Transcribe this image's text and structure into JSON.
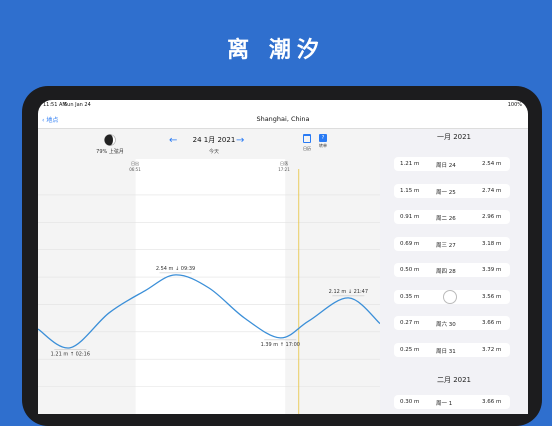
{
  "headline": "离 潮汐",
  "status_bar": {
    "time": "11:51 AM",
    "date": "Sun Jan 24",
    "right": "100%"
  },
  "nav": {
    "back_label": "地点",
    "title": "Shanghai, China"
  },
  "moon": {
    "percent_label": "79% 上弦月"
  },
  "date_nav": {
    "date": "24 1月 2021",
    "sub": "今天",
    "prev_icon": "arrow-left-icon",
    "next_icon": "arrow-right-icon"
  },
  "toolbar": {
    "calendar_label": "日历",
    "calendar_icon": "calendar-icon",
    "today_label": "转单",
    "today_icon": "question-icon"
  },
  "sun": {
    "sunrise_label": "日出",
    "sunrise_time": "06:51",
    "sunset_label": "日落",
    "sunset_time": "17:21"
  },
  "chart_data": {
    "type": "line",
    "x_range_hours": [
      0,
      24
    ],
    "y_range_m": [
      0,
      4.4
    ],
    "daylight_hours": [
      6.85,
      17.35
    ],
    "current_hour": 18.3,
    "series": [
      {
        "values": [
          [
            0,
            1.55
          ],
          [
            2.27,
            1.21
          ],
          [
            5,
            1.85
          ],
          [
            7.5,
            2.25
          ],
          [
            9.65,
            2.54
          ],
          [
            12,
            2.3
          ],
          [
            14.5,
            1.75
          ],
          [
            17,
            1.39
          ],
          [
            19,
            1.7
          ],
          [
            21.78,
            2.12
          ],
          [
            24,
            1.65
          ]
        ]
      }
    ],
    "annotations": [
      {
        "label": "2.54 m ↓ 09:39",
        "hour": 9.65,
        "value": 2.54
      },
      {
        "label": "1.21 m ↑ 02:16",
        "hour": 2.27,
        "value": 1.21
      },
      {
        "label": "1.39 m ↑ 17:00",
        "hour": 17.0,
        "value": 1.39
      },
      {
        "label": "2.12 m ↓ 21:47",
        "hour": 21.78,
        "value": 2.12
      }
    ]
  },
  "sidebar": {
    "month1": "一月 2021",
    "rows": [
      {
        "low": "1.21 m",
        "day": "周日 24",
        "high": "2.54 m"
      },
      {
        "low": "1.15 m",
        "day": "周一 25",
        "high": "2.74 m"
      },
      {
        "low": "0.91 m",
        "day": "周二 26",
        "high": "2.96 m"
      },
      {
        "low": "0.69 m",
        "day": "周三 27",
        "high": "3.18 m"
      },
      {
        "low": "0.50 m",
        "day": "周四 28",
        "high": "3.39 m"
      },
      {
        "low": "0.35 m",
        "day": "",
        "high": "3.56 m",
        "moon": true
      },
      {
        "low": "0.27 m",
        "day": "周六 30",
        "high": "3.66 m"
      },
      {
        "low": "0.25 m",
        "day": "周日 31",
        "high": "3.72 m"
      }
    ],
    "month2": "二月 2021",
    "rows2": [
      {
        "low": "0.30 m",
        "day": "周一 1",
        "high": "3.66 m"
      }
    ]
  }
}
